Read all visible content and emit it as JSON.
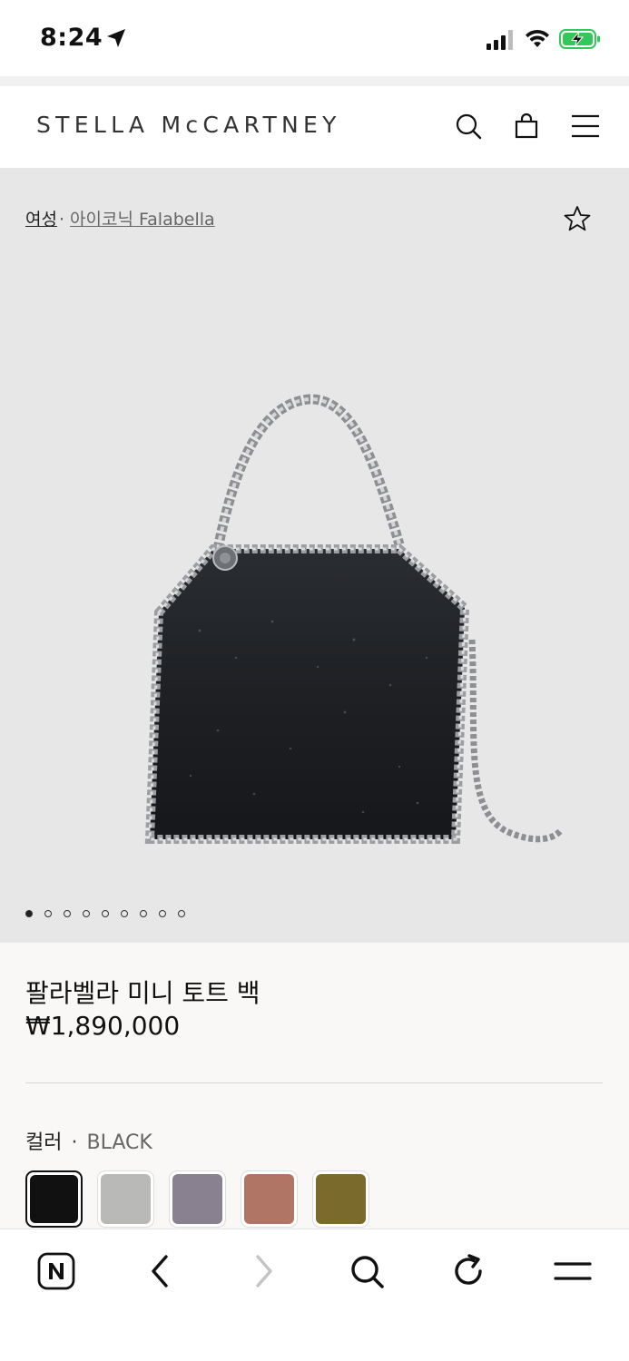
{
  "status_bar": {
    "time": "8:24",
    "icons": [
      "location-arrow-icon",
      "signal-icon",
      "wifi-icon",
      "battery-charging-icon"
    ],
    "battery_color": "#34c759"
  },
  "header": {
    "brand": "STELLA McCARTNEY",
    "icons": [
      "search-icon",
      "shopping-bag-icon",
      "menu-icon"
    ]
  },
  "gallery": {
    "breadcrumb": {
      "home": "여성",
      "separator": "·",
      "category": "아이코닉 Falabella"
    },
    "wishlist_icon": "star-outline-icon",
    "image_count": 9,
    "active_image_index": 0,
    "background": "#e7e7e8"
  },
  "product": {
    "name": "팔라벨라 미니 토트 백",
    "price": "₩1,890,000",
    "color_label": "컬러",
    "color_separator": "·",
    "color_value": "BLACK",
    "swatches": [
      {
        "color": "#111111",
        "selected": true
      },
      {
        "color": "#b9b9b8",
        "selected": false
      },
      {
        "color": "#8a8190",
        "selected": false
      },
      {
        "color": "#b07565",
        "selected": false
      },
      {
        "color": "#7a6a2c",
        "selected": false
      }
    ]
  },
  "toolbar": {
    "icons": [
      "naver-n-icon",
      "back-arrow-icon",
      "forward-arrow-icon",
      "search-icon",
      "reload-icon",
      "menu-icon"
    ]
  }
}
